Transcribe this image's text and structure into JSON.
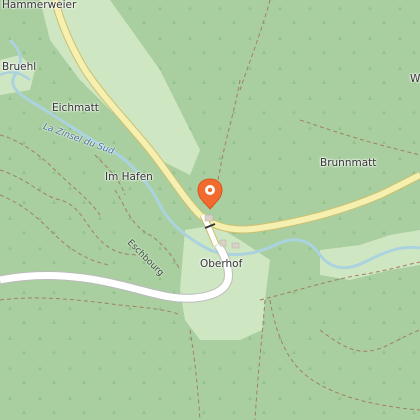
{
  "map": {
    "places": {
      "hammerweier": "Hammerweier",
      "bruehl": "Bruehl",
      "eichmatt": "Eichmatt",
      "im_hafen": "Im Hafen",
      "brunnmatt": "Brunnmatt",
      "oberhof": "Oberhof",
      "edge_w": "W"
    },
    "roads": {
      "eschbourg": "Eschbourg"
    },
    "waterways": {
      "zinsel": "La Zinsel du Sud"
    },
    "marker": {
      "icon": "location-pin-icon",
      "color": "#f26a2e"
    },
    "colors": {
      "forest": "#a9cfa0",
      "meadow": "#cfe6c2",
      "water": "#aad3df",
      "main_road": "#f5f0b0",
      "road_casing": "#cdbf6e"
    }
  }
}
